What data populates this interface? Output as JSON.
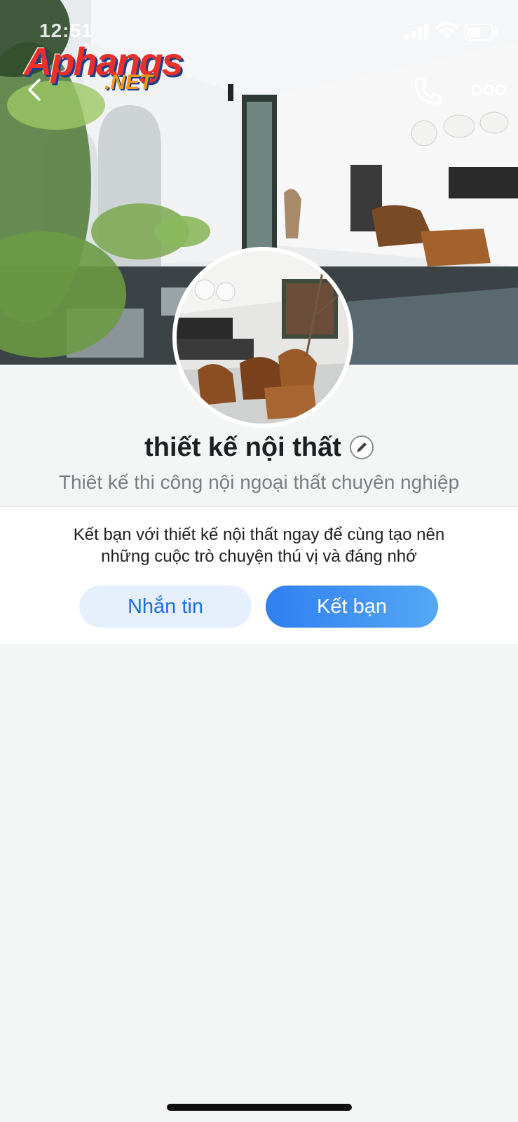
{
  "status_bar": {
    "time": "12:51",
    "icons": [
      "cellular-signal-icon",
      "wifi-icon",
      "battery-icon"
    ]
  },
  "watermark": {
    "logo_main": "Aphangs",
    "logo_suffix": ".NET"
  },
  "nav": {
    "back_icon": "chevron-left-icon",
    "call_icon": "phone-icon",
    "more_icon": "more-dots-icon"
  },
  "profile": {
    "name": "thiết kế nội thất",
    "edit_icon": "pencil-icon",
    "bio": "Thiêt kế thi công nội ngoại thất chuyên nghiệp"
  },
  "friend_prompt": {
    "line1": "Kết bạn với thiết kế nội thất ngay để cùng tạo nên",
    "line2": "những cuộc trò chuyện thú vị và đáng nhớ"
  },
  "actions": {
    "message_label": "Nhắn tin",
    "add_friend_label": "Kết bạn"
  },
  "colors": {
    "primary": "#2f7ff0",
    "message_bg": "#e6f0fd",
    "background": "#f4f5f5"
  }
}
